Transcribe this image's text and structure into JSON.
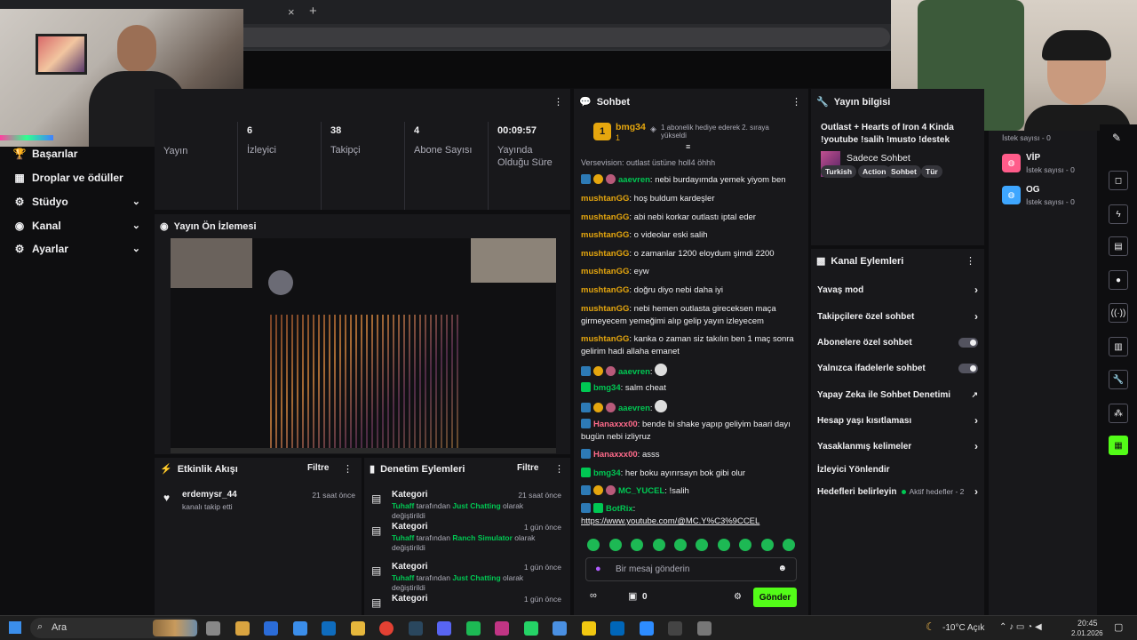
{
  "browser": {
    "new_tab_label": "+",
    "close_tab_label": "×"
  },
  "nav": {
    "items": [
      {
        "label": "Başarılar",
        "icon": "trophy-icon",
        "glyph": "🏆",
        "has_chevron": false
      },
      {
        "label": "Droplar ve ödüller",
        "icon": "gift-icon",
        "glyph": "▦",
        "has_chevron": false
      },
      {
        "label": "Stüdyo",
        "icon": "studio-icon",
        "glyph": "⚙",
        "has_chevron": true
      },
      {
        "label": "Kanal",
        "icon": "channel-icon",
        "glyph": "◉",
        "has_chevron": true
      },
      {
        "label": "Ayarlar",
        "icon": "gear-icon",
        "glyph": "⚙",
        "has_chevron": true
      }
    ],
    "chevron": "⌄"
  },
  "stats": [
    {
      "value": "",
      "label": "Yayın"
    },
    {
      "value": "6",
      "label": "İzleyici"
    },
    {
      "value": "38",
      "label": "Takipçi"
    },
    {
      "value": "4",
      "label": "Abone Sayısı"
    },
    {
      "value": "00:09:57",
      "label": "Yayında Olduğu Süre"
    }
  ],
  "preview": {
    "title": "Yayın Ön İzlemesi"
  },
  "activity": {
    "title": "Etkinlik Akışı",
    "filter": "Filtre",
    "items": [
      {
        "user": "erdemysr_44",
        "text": "kanalı takip etti",
        "time": "21 saat önce"
      }
    ]
  },
  "moderation": {
    "title": "Denetim Eylemleri",
    "filter": "Filtre",
    "items": [
      {
        "title": "Kategori",
        "time": "21 saat önce",
        "by": "Tuhaff",
        "middle": " tarafından ",
        "cat": "Just Chatting",
        "suffix": " olarak değiştirildi"
      },
      {
        "title": "Kategori",
        "time": "1 gün önce",
        "by": "Tuhaff",
        "middle": " tarafından ",
        "cat": "Ranch Simulator",
        "suffix": " olarak değiştirildi"
      },
      {
        "title": "Kategori",
        "time": "1 gün önce",
        "by": "Tuhaff",
        "middle": " tarafından ",
        "cat": "Just Chatting",
        "suffix": " olarak değiştirildi"
      },
      {
        "title": "Kategori",
        "time": "1 gün önce",
        "by": "",
        "middle": "",
        "cat": "",
        "suffix": ""
      }
    ]
  },
  "chat": {
    "title": "Sohbet",
    "pinned": {
      "user": "bmg34",
      "count": "1",
      "rank": "1",
      "text": "1 abonelik hediye ederek 2. sıraya yükseldi"
    },
    "top_partial": "Versevision: outlast üstüne holl4 öhhh",
    "messages": [
      {
        "user": "aaevren",
        "color": "#00c853",
        "badges": [
          "b-blue",
          "b-gold",
          "b-pink"
        ],
        "text": "nebi burdayımda yemek yiyom ben"
      },
      {
        "user": "mushtanGG",
        "color": "#e5a60e",
        "badges": [],
        "text": "hoş buldum kardeşler"
      },
      {
        "user": "mushtanGG",
        "color": "#e5a60e",
        "badges": [],
        "text": "abi nebi korkar outlastı iptal eder"
      },
      {
        "user": "mushtanGG",
        "color": "#e5a60e",
        "badges": [],
        "text": "o videolar eski salih"
      },
      {
        "user": "mushtanGG",
        "color": "#e5a60e",
        "badges": [],
        "text": "o zamanlar 1200 eloydum şimdi 2200"
      },
      {
        "user": "mushtanGG",
        "color": "#e5a60e",
        "badges": [],
        "text": "eyw"
      },
      {
        "user": "mushtanGG",
        "color": "#e5a60e",
        "badges": [],
        "text": "doğru diyo nebi daha iyi"
      },
      {
        "user": "mushtanGG",
        "color": "#e5a60e",
        "badges": [],
        "text": "nebi hemen outlasta gireceksen maça girmeyecem yemeğimi alıp gelip yayın izleyecem"
      },
      {
        "user": "mushtanGG",
        "color": "#e5a60e",
        "badges": [],
        "text": "kanka o zaman siz takılın ben 1 maç sonra gelirim hadi allaha emanet"
      },
      {
        "user": "aaevren",
        "color": "#00c853",
        "badges": [
          "b-blue",
          "b-gold",
          "b-pink"
        ],
        "text": ""
      },
      {
        "user": "bmg34",
        "color": "#00c853",
        "badges": [
          "b-green"
        ],
        "text": "salm cheat"
      },
      {
        "user": "aaevren",
        "color": "#00c853",
        "badges": [
          "b-blue",
          "b-gold",
          "b-pink"
        ],
        "text": ""
      },
      {
        "user": "Hanaxxx00",
        "color": "#ff6b8b",
        "badges": [
          "b-blue"
        ],
        "text": "bende bi shake yapıp geliyim baari dayı bugün nebi izliyruz"
      },
      {
        "user": "Hanaxxx00",
        "color": "#ff6b8b",
        "badges": [
          "b-blue"
        ],
        "text": "asss"
      },
      {
        "user": "bmg34",
        "color": "#00c853",
        "badges": [
          "b-green"
        ],
        "text": "her boku ayırırsayn bok gibi olur"
      },
      {
        "user": "MC_YUCEL",
        "color": "#00c853",
        "badges": [
          "b-blue",
          "b-gold",
          "b-pink"
        ],
        "text": "!salih"
      },
      {
        "user": "BotRix",
        "color": "#00c853",
        "badges": [
          "b-blue",
          "b-green"
        ],
        "text": ""
      }
    ],
    "link": "https://www.youtube.com/@MC.Y%C3%9CCEL",
    "input_placeholder": "Bir mesaj gönderin",
    "viewers_icon": "∞",
    "gift_count": "0",
    "send_label": "Gönder"
  },
  "stream_info": {
    "title": "Yayın bilgisi",
    "stream_title": "Outlast + Hearts of Iron 4 Kinda !youtube !salih !musto !destek",
    "category": "Sadece Sohbet",
    "tags": [
      "Turkish",
      "Action",
      "Sohbet",
      "Tür"
    ]
  },
  "requests": {
    "header_count": "İstek sayısı - 0",
    "items": [
      {
        "name": "VİP",
        "count": "İstek sayısı - 0",
        "color": "#ff5c8a"
      },
      {
        "name": "OG",
        "count": "İstek sayısı - 0",
        "color": "#3ea6ff"
      }
    ]
  },
  "channel_actions": {
    "title": "Kanal Eylemleri",
    "items": [
      {
        "label": "Yavaş mod",
        "kind": "arrow"
      },
      {
        "label": "Takipçilere özel sohbet",
        "kind": "arrow"
      },
      {
        "label": "Abonelere özel sohbet",
        "kind": "toggle"
      },
      {
        "label": "Yalnızca ifadelerle sohbet",
        "kind": "toggle"
      },
      {
        "label": "Yapay Zeka ile Sohbet Denetimi",
        "kind": "ext"
      },
      {
        "label": "Hesap yaşı kısıtlaması",
        "kind": "arrow"
      },
      {
        "label": "Yasaklanmış kelimeler",
        "kind": "arrow"
      },
      {
        "label": "İzleyici Yönlendir",
        "kind": "none"
      },
      {
        "label": "Hedefleri belirleyin",
        "kind": "arrow",
        "extra": "Aktif hedefler - 2"
      }
    ]
  },
  "taskbar": {
    "search": "Ara",
    "weather": "-10°C  Açık",
    "time": "20:45",
    "date": "2.01.2026"
  },
  "colors": {
    "accent": "#53fc18",
    "kick_green": "#00c853",
    "bg": "#0e0e10",
    "panel": "#18181b"
  }
}
